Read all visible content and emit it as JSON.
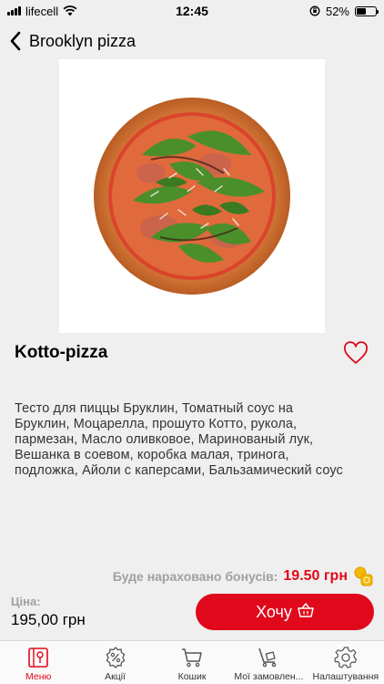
{
  "status_bar": {
    "carrier": "lifecell",
    "time": "12:45",
    "battery": "52%",
    "battery_level": 0.52
  },
  "header": {
    "back_label": "Brooklyn pizza"
  },
  "product": {
    "title": "Kotto-pizza",
    "description": "Тесто для пиццы Бруклин, Томатный соус на Бруклин, Моцарелла, прошуто Котто, рукола, пармезан, Масло оливковое, Маринованый лук, Вешанка в соевом, коробка малая, триногa, подложка, Айоли с каперсами, Бальзамический соус",
    "favorite_icon": "heart-outline-icon"
  },
  "bonus": {
    "label": "Буде нараховано бонусів:",
    "value": "19.50 грн",
    "icon": "coin-icon"
  },
  "price": {
    "label": "Ціна:",
    "value": "195,00 грн"
  },
  "cta": {
    "label": "Хочу",
    "icon": "basket-icon"
  },
  "tabs": [
    {
      "label": "Меню",
      "icon": "menu-book-icon",
      "active": true
    },
    {
      "label": "Акції",
      "icon": "discount-icon",
      "active": false
    },
    {
      "label": "Кошик",
      "icon": "cart-icon",
      "active": false
    },
    {
      "label": "Мої замовлен...",
      "icon": "orders-icon",
      "active": false
    },
    {
      "label": "Налаштування",
      "icon": "gear-icon",
      "active": false
    }
  ],
  "colors": {
    "accent": "#e0091b",
    "background": "#efefef",
    "muted_text": "#a0a0a0",
    "coin": "#f5b700"
  }
}
